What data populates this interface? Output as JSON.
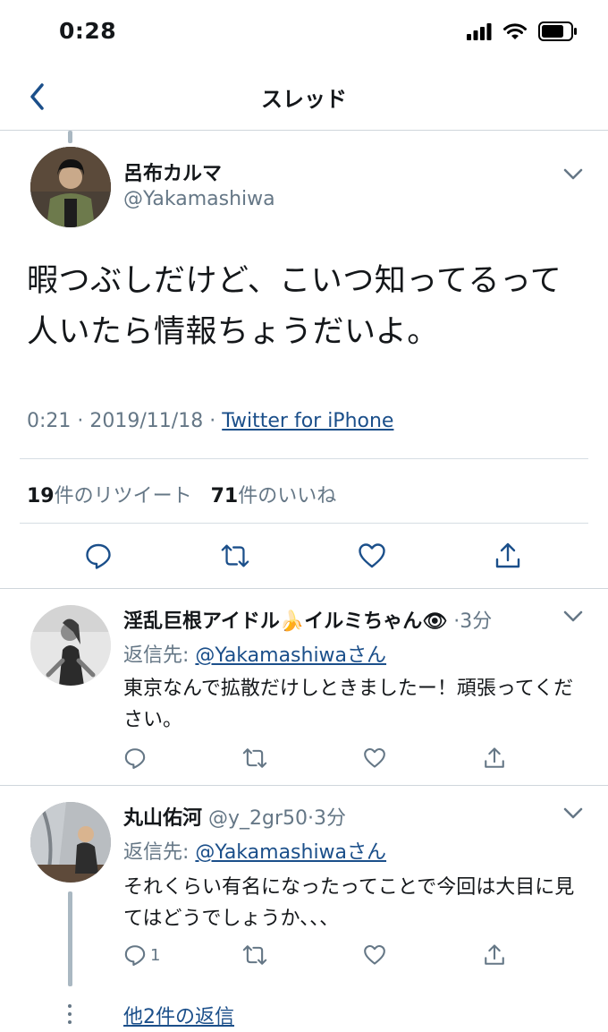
{
  "status_bar": {
    "time": "0:28"
  },
  "nav": {
    "title": "スレッド"
  },
  "main_tweet": {
    "name": "呂布カルマ",
    "handle": "@Yakamashiwa",
    "text": "暇つぶしだけど、こいつ知ってるって人いたら情報ちょうだいよ。",
    "time": "0:21",
    "date": "2019/11/18",
    "separator": "·",
    "source": "Twitter for iPhone",
    "retweet_count": "19",
    "retweet_label": "件のリツイート",
    "like_count": "71",
    "like_label": "件のいいね"
  },
  "replies": [
    {
      "name": "淫乱巨根アイドル🍌イルミちゃん👁",
      "handle": "",
      "time": "·3分",
      "reply_prefix": "返信先: ",
      "reply_to": "@Yakamashiwaさん",
      "text": "東京なんで拡散だけしときましたー！頑張ってください。",
      "reply_count": ""
    },
    {
      "name": "丸山佑河",
      "handle": "@y_2gr50",
      "time": "·3分",
      "reply_prefix": "返信先: ",
      "reply_to": "@Yakamashiwaさん",
      "text": "それくらい有名になったってことで今回は大目に見てはどうでしょうか、、、",
      "reply_count": "1"
    }
  ],
  "more_replies": "他2件の返信",
  "colors": {
    "link": "#1b4f8a",
    "muted": "#657786",
    "text": "#14171a",
    "accent": "#1da1f2"
  },
  "icons": [
    "back-chevron-icon",
    "chevron-down-icon",
    "reply-icon",
    "retweet-icon",
    "like-icon",
    "share-icon",
    "signal-icon",
    "wifi-icon",
    "battery-icon"
  ]
}
